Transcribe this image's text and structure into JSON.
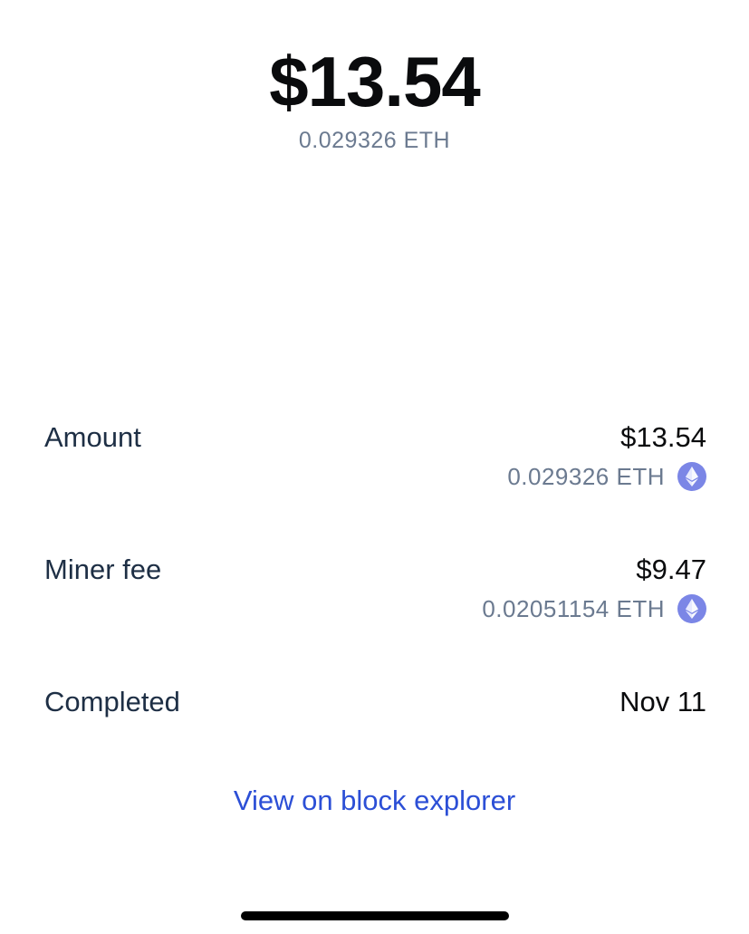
{
  "header": {
    "amount_usd": "$13.54",
    "amount_eth": "0.029326 ETH"
  },
  "details": {
    "amount": {
      "label": "Amount",
      "usd": "$13.54",
      "eth": "0.029326 ETH",
      "icon": "ethereum-icon"
    },
    "miner_fee": {
      "label": "Miner fee",
      "usd": "$9.47",
      "eth": "0.02051154 ETH",
      "icon": "ethereum-icon"
    },
    "status": {
      "label": "Completed",
      "value": "Nov 11"
    }
  },
  "actions": {
    "explorer_link": "View on block explorer"
  },
  "colors": {
    "primary_text": "#0a0b0d",
    "secondary_text": "#6b7a90",
    "label_text": "#1e2f45",
    "link": "#2c4fd6",
    "eth_icon": "#7b86e6"
  }
}
